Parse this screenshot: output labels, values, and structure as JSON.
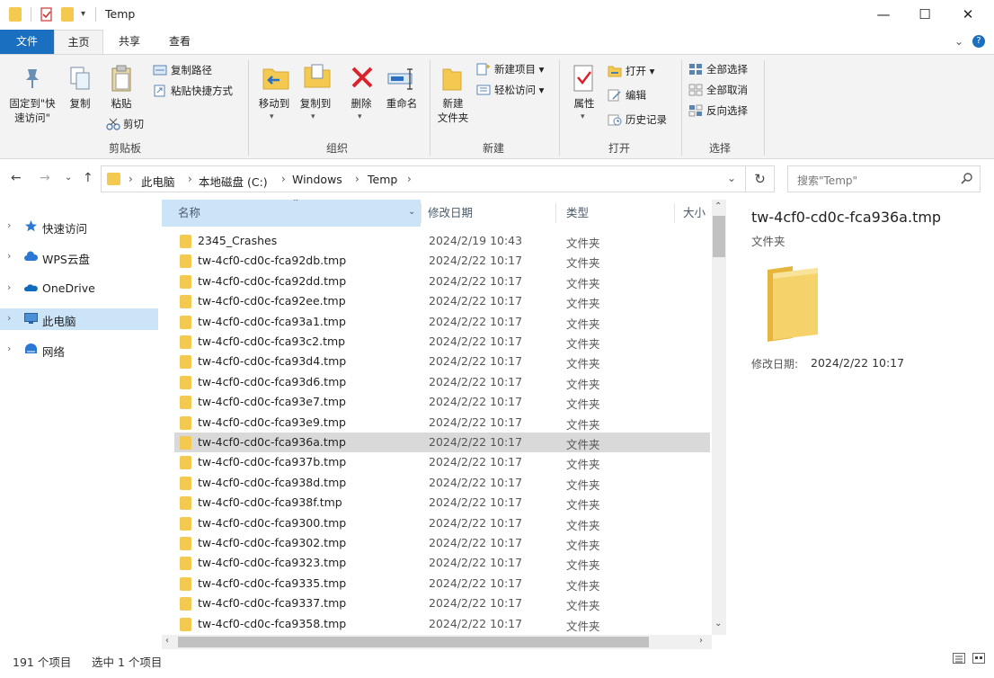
{
  "window": {
    "title": "Temp",
    "controls": {
      "minimize": "—",
      "maximize": "☐",
      "close": "✕"
    },
    "help_icon": "?",
    "collapse_icon": "⌄"
  },
  "tabs": [
    {
      "label": "文件",
      "state": "file"
    },
    {
      "label": "主页",
      "state": "active"
    },
    {
      "label": "共享",
      "state": "normal"
    },
    {
      "label": "查看",
      "state": "normal"
    }
  ],
  "ribbon": {
    "clipboard": {
      "label": "剪贴板",
      "pin": "固定到\"快\n速访问\"",
      "copy": "复制",
      "paste": "粘贴",
      "copy_path": "复制路径",
      "paste_shortcut": "粘贴快捷方式",
      "cut": "剪切"
    },
    "organize": {
      "label": "组织",
      "move_to": "移动到",
      "copy_to": "复制到",
      "delete": "删除",
      "rename": "重命名"
    },
    "new": {
      "label": "新建",
      "new_folder": "新建\n文件夹",
      "new_item": "新建项目 ▾",
      "easy_access": "轻松访问 ▾"
    },
    "open": {
      "label": "打开",
      "properties": "属性",
      "open": "打开 ▾",
      "edit": "编辑",
      "history": "历史记录"
    },
    "select": {
      "label": "选择",
      "select_all": "全部选择",
      "select_none": "全部取消",
      "invert": "反向选择"
    }
  },
  "address": {
    "crumbs": [
      "此电脑",
      "本地磁盘 (C:)",
      "Windows",
      "Temp"
    ],
    "search_placeholder": "搜索\"Temp\""
  },
  "nav_pane": [
    {
      "label": "快速访问",
      "icon": "star-icon",
      "selected": false
    },
    {
      "label": "WPS云盘",
      "icon": "cloud-icon",
      "selected": false
    },
    {
      "label": "OneDrive",
      "icon": "onedrive-icon",
      "selected": false
    },
    {
      "label": "此电脑",
      "icon": "pc-icon",
      "selected": true
    },
    {
      "label": "网络",
      "icon": "network-icon",
      "selected": false
    }
  ],
  "columns": {
    "name": "名称",
    "date": "修改日期",
    "type": "类型",
    "size": "大小"
  },
  "files": [
    {
      "name": "2345_Crashes",
      "date": "2024/2/19 10:43",
      "type": "文件夹"
    },
    {
      "name": "tw-4cf0-cd0c-fca92db.tmp",
      "date": "2024/2/22 10:17",
      "type": "文件夹"
    },
    {
      "name": "tw-4cf0-cd0c-fca92dd.tmp",
      "date": "2024/2/22 10:17",
      "type": "文件夹"
    },
    {
      "name": "tw-4cf0-cd0c-fca92ee.tmp",
      "date": "2024/2/22 10:17",
      "type": "文件夹"
    },
    {
      "name": "tw-4cf0-cd0c-fca93a1.tmp",
      "date": "2024/2/22 10:17",
      "type": "文件夹"
    },
    {
      "name": "tw-4cf0-cd0c-fca93c2.tmp",
      "date": "2024/2/22 10:17",
      "type": "文件夹"
    },
    {
      "name": "tw-4cf0-cd0c-fca93d4.tmp",
      "date": "2024/2/22 10:17",
      "type": "文件夹"
    },
    {
      "name": "tw-4cf0-cd0c-fca93d6.tmp",
      "date": "2024/2/22 10:17",
      "type": "文件夹"
    },
    {
      "name": "tw-4cf0-cd0c-fca93e7.tmp",
      "date": "2024/2/22 10:17",
      "type": "文件夹"
    },
    {
      "name": "tw-4cf0-cd0c-fca93e9.tmp",
      "date": "2024/2/22 10:17",
      "type": "文件夹"
    },
    {
      "name": "tw-4cf0-cd0c-fca936a.tmp",
      "date": "2024/2/22 10:17",
      "type": "文件夹",
      "selected": true
    },
    {
      "name": "tw-4cf0-cd0c-fca937b.tmp",
      "date": "2024/2/22 10:17",
      "type": "文件夹"
    },
    {
      "name": "tw-4cf0-cd0c-fca938d.tmp",
      "date": "2024/2/22 10:17",
      "type": "文件夹"
    },
    {
      "name": "tw-4cf0-cd0c-fca938f.tmp",
      "date": "2024/2/22 10:17",
      "type": "文件夹"
    },
    {
      "name": "tw-4cf0-cd0c-fca9300.tmp",
      "date": "2024/2/22 10:17",
      "type": "文件夹"
    },
    {
      "name": "tw-4cf0-cd0c-fca9302.tmp",
      "date": "2024/2/22 10:17",
      "type": "文件夹"
    },
    {
      "name": "tw-4cf0-cd0c-fca9323.tmp",
      "date": "2024/2/22 10:17",
      "type": "文件夹"
    },
    {
      "name": "tw-4cf0-cd0c-fca9335.tmp",
      "date": "2024/2/22 10:17",
      "type": "文件夹"
    },
    {
      "name": "tw-4cf0-cd0c-fca9337.tmp",
      "date": "2024/2/22 10:17",
      "type": "文件夹"
    },
    {
      "name": "tw-4cf0-cd0c-fca9358.tmp",
      "date": "2024/2/22 10:17",
      "type": "文件夹"
    }
  ],
  "preview": {
    "name": "tw-4cf0-cd0c-fca936a.tmp",
    "type": "文件夹",
    "date_label": "修改日期:",
    "date_value": "2024/2/22 10:17"
  },
  "status": {
    "count": "191 个项目",
    "selected": "选中 1 个项目"
  },
  "colors": {
    "accent": "#1a6fc1",
    "folder": "#f3c94f",
    "selection": "#cce4f7",
    "row_selected": "#d9d9d9"
  }
}
